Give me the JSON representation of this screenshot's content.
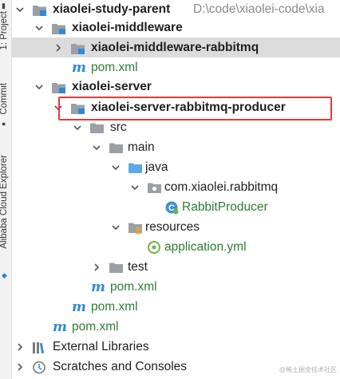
{
  "sidebar": {
    "top_label": "1: Project",
    "commit_label": "Commit",
    "explorer_label": "Alibaba Cloud Explorer"
  },
  "tree": [
    {
      "label": "xiaolei-study-parent",
      "path": "D:\\code\\xiaolei-code\\xia",
      "icon": "module-folder-icon",
      "expanded": true
    },
    {
      "label": "xiaolei-middleware",
      "icon": "module-folder-icon",
      "expanded": true
    },
    {
      "label": "xiaolei-middleware-rabbitmq",
      "icon": "module-folder-icon",
      "expanded": false
    },
    {
      "label": "pom.xml",
      "icon": "maven-icon"
    },
    {
      "label": "xiaolei-server",
      "icon": "module-folder-icon",
      "expanded": true
    },
    {
      "label": "xiaolei-server-rabbitmq-producer",
      "icon": "module-folder-icon",
      "expanded": true
    },
    {
      "label": "src",
      "icon": "folder-icon",
      "expanded": true
    },
    {
      "label": "main",
      "icon": "folder-icon",
      "expanded": true
    },
    {
      "label": "java",
      "icon": "source-folder-icon",
      "expanded": true
    },
    {
      "label": "com.xiaolei.rabbitmq",
      "icon": "package-icon",
      "expanded": true
    },
    {
      "label": "RabbitProducer",
      "icon": "spring-class-icon"
    },
    {
      "label": "resources",
      "icon": "resources-folder-icon",
      "expanded": true
    },
    {
      "label": "application.yml",
      "icon": "spring-config-icon"
    },
    {
      "label": "test",
      "icon": "folder-icon",
      "expanded": false
    },
    {
      "label": "pom.xml",
      "icon": "maven-icon"
    },
    {
      "label": "pom.xml",
      "icon": "maven-icon"
    },
    {
      "label": "pom.xml",
      "icon": "maven-icon"
    },
    {
      "label": "External Libraries",
      "icon": "libraries-icon",
      "expanded": false
    },
    {
      "label": "Scratches and Consoles",
      "icon": "scratches-icon",
      "expanded": false
    }
  ],
  "watermark": "@稀土掘金技术社区",
  "colors": {
    "selection": "#dcdcdc",
    "highlight_border": "#e53935",
    "file_green": "#2e7d32",
    "folder_blue": "#5fa8e8",
    "folder_gray": "#9aa0a6"
  }
}
